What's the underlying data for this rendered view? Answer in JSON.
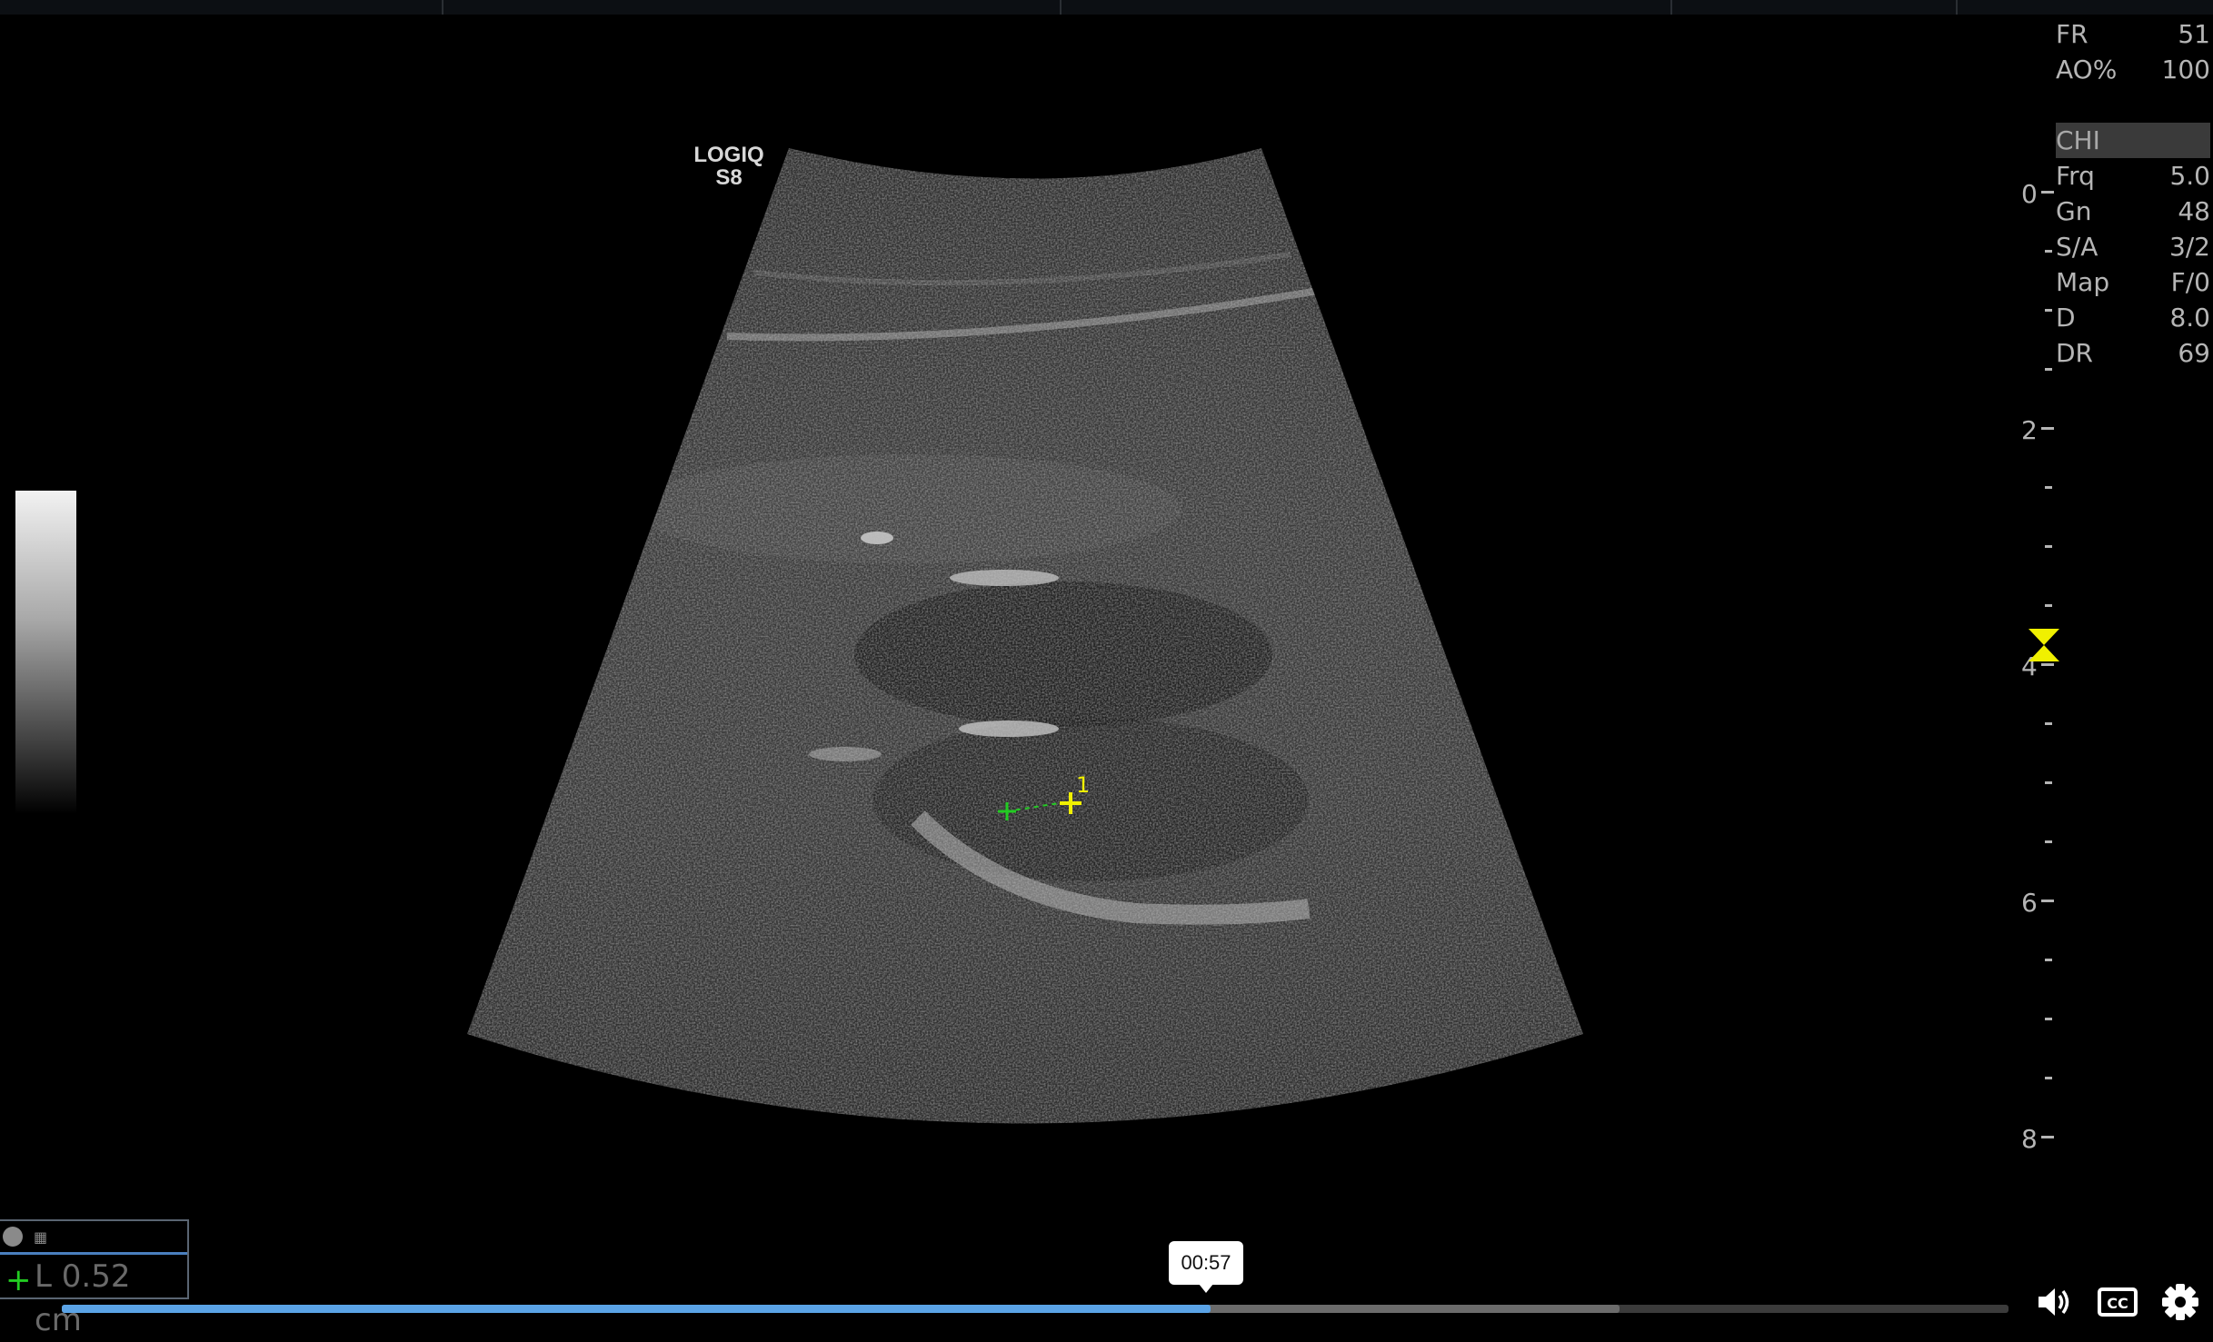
{
  "device": {
    "brand_line1": "LOGIQ",
    "brand_line2": "S8"
  },
  "parameters": [
    {
      "label": "FR",
      "value": "51"
    },
    {
      "label": "AO%",
      "value": "100"
    },
    {
      "label": "CHI",
      "value": "",
      "highlight": true
    },
    {
      "label": "Frq",
      "value": "5.0"
    },
    {
      "label": "Gn",
      "value": "48"
    },
    {
      "label": "S/A",
      "value": "3/2"
    },
    {
      "label": "Map",
      "value": "F/0"
    },
    {
      "label": "D",
      "value": "8.0"
    },
    {
      "label": "DR",
      "value": "69"
    }
  ],
  "depth_scale": {
    "labels": [
      "0",
      "2",
      "4",
      "6",
      "8"
    ],
    "max_cm": 8
  },
  "caliper": {
    "marker_index": "1"
  },
  "measurement": {
    "label": "L",
    "value": "0.52 cm"
  },
  "player": {
    "current_time": "00:57",
    "progress_fraction": 0.59,
    "buffered_fraction": 0.8,
    "controls": [
      "volume-icon",
      "closed-captions-icon",
      "settings-gear-icon"
    ],
    "cc_label": "CC"
  },
  "colors": {
    "progress": "#5aa3e6",
    "caliper_start": "#22cc22",
    "caliper_end": "#f0f000",
    "focus_marker": "#f0f000"
  }
}
